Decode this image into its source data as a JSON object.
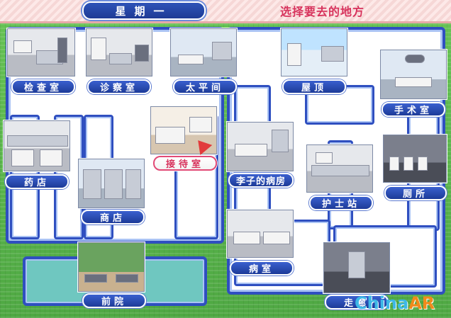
{
  "header": {
    "day_label": "星期一",
    "title": "选择要去的地方"
  },
  "rooms": {
    "exam": {
      "label": "检查室"
    },
    "consult": {
      "label": "诊察室"
    },
    "morgue": {
      "label": "太平间"
    },
    "rooftop": {
      "label": "屋顶"
    },
    "surgery": {
      "label": "手术室"
    },
    "pharmacy": {
      "label": "药店"
    },
    "reception": {
      "label": "接待室"
    },
    "shop": {
      "label": "商店"
    },
    "lizi_ward": {
      "label": "李子的病房"
    },
    "nurse_station": {
      "label": "护士站"
    },
    "restroom": {
      "label": "厕所"
    },
    "ward": {
      "label": "病室"
    },
    "front_yard": {
      "label": "前院"
    },
    "corridor": {
      "label": "走廊"
    }
  },
  "selected_room": "接待室",
  "icons": {
    "pointer": "red-arrow-pointer-icon"
  },
  "watermark": {
    "text_main": "China",
    "text_accent": "AR"
  },
  "colors": {
    "accent": "#d7325c",
    "label_blue": "#2f4fc0",
    "grass": "#5bb84a",
    "header_pink": "#f6d7d6"
  }
}
